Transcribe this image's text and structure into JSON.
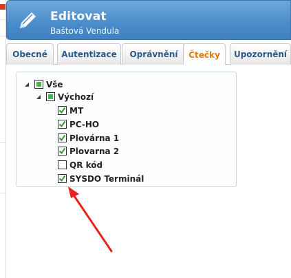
{
  "dialog": {
    "title": "Editovat",
    "subtitle": "Baštová Vendula"
  },
  "tabs": [
    {
      "label": "Obecné"
    },
    {
      "label": "Autentizace"
    },
    {
      "label": "Oprávnění"
    },
    {
      "label": "Čtečky",
      "active": true
    },
    {
      "label": "Upozornění"
    }
  ],
  "tree": {
    "root": {
      "label": "Vše",
      "state": "partial"
    },
    "group": {
      "label": "Výchozí",
      "state": "partial"
    },
    "items": [
      {
        "label": "MT",
        "checked": true
      },
      {
        "label": "PC-HO",
        "checked": true
      },
      {
        "label": "Plovárna 1",
        "checked": true
      },
      {
        "label": "Plovarna 2",
        "checked": true
      },
      {
        "label": "QR kód",
        "checked": false
      },
      {
        "label": "SYSDO Terminál",
        "checked": true
      }
    ]
  },
  "colors": {
    "header": "#4a8ccb",
    "active_tab": "#e07b00",
    "tab_text": "#2a5a8a",
    "check": "#2e9a2e",
    "arrow": "#e8211b"
  },
  "icons": {
    "header": "pencil-icon",
    "expander": "triangle-down-icon",
    "checkbox": "checkmark-icon"
  }
}
